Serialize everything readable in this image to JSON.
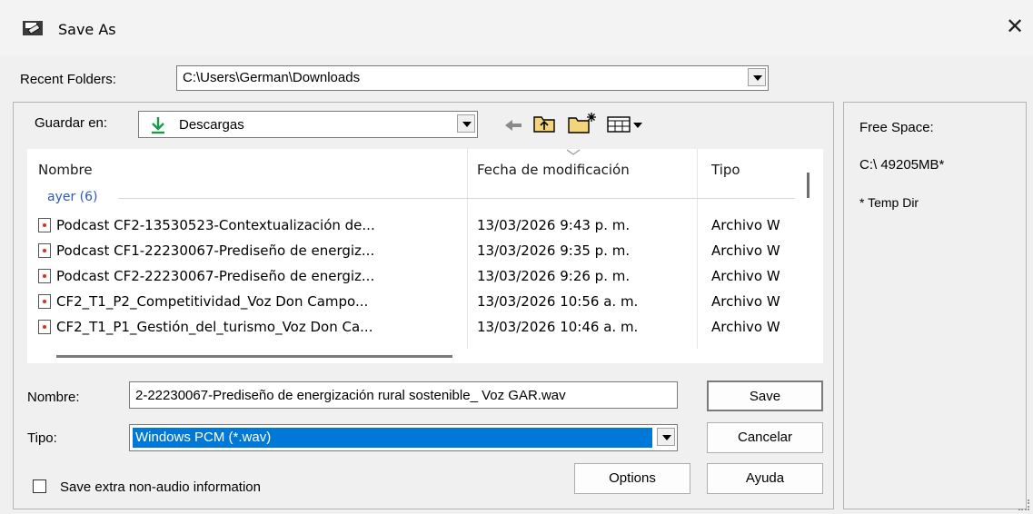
{
  "window": {
    "title": "Save As",
    "close_glyph": "✕",
    "app_icon": "save-disk-icon"
  },
  "recent_folders": {
    "label": "Recent Folders:",
    "value": "C:\\Users\\German\\Downloads"
  },
  "save_in": {
    "label": "Guardar en:",
    "value": "Descargas",
    "icon": "download-arrow-icon"
  },
  "toolbar": {
    "back_icon": "back-arrow-icon",
    "up_icon": "up-folder-icon",
    "new_folder_icon": "new-folder-icon",
    "view_icon": "view-menu-icon"
  },
  "file_list": {
    "columns": [
      "Nombre",
      "Fecha de modificación",
      "Tipo"
    ],
    "group": "ayer (6)",
    "rows": [
      {
        "name": "Podcast CF2-13530523-Contextualización de...",
        "date": "13/03/2026 9:43 p. m.",
        "type": "Archivo W"
      },
      {
        "name": "Podcast CF1-22230067-Prediseño de energiz...",
        "date": "13/03/2026 9:35 p. m.",
        "type": "Archivo W"
      },
      {
        "name": "Podcast CF2-22230067-Prediseño de energiz...",
        "date": "13/03/2026 9:26 p. m.",
        "type": "Archivo W"
      },
      {
        "name": "CF2_T1_P2_Competitividad_Voz Don Campo...",
        "date": "13/03/2026 10:56 a. m.",
        "type": "Archivo W"
      },
      {
        "name": "CF2_T1_P1_Gestión_del_turismo_Voz Don Ca...",
        "date": "13/03/2026 10:46 a. m.",
        "type": "Archivo W"
      }
    ]
  },
  "filename": {
    "label": "Nombre:",
    "value": "2-22230067-Prediseño de energización rural sostenible_ Voz GAR.wav"
  },
  "filetype": {
    "label": "Tipo:",
    "value": "Windows PCM (*.wav)"
  },
  "buttons": {
    "save": "Save",
    "cancel": "Cancelar",
    "options": "Options",
    "help": "Ayuda"
  },
  "extra_checkbox": {
    "label": "Save extra non-audio information",
    "checked": false
  },
  "side_panel": {
    "free_space_label": "Free Space:",
    "drive": "C:\\  49205MB*",
    "note": "* Temp Dir"
  },
  "colors": {
    "selection": "#0078d7",
    "group_text": "#2a5ab8",
    "download_icon": "#1a9a4a"
  }
}
